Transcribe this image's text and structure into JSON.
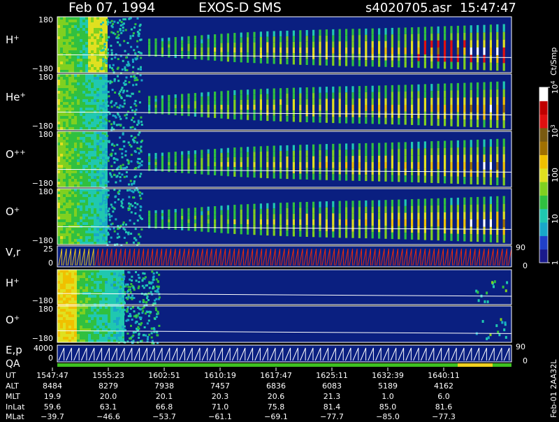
{
  "header": {
    "date": "Feb 07, 1994",
    "mission": "EXOS-D SMS",
    "file": "s4020705.asr",
    "time": "15:47:47"
  },
  "colors": {
    "background": "#000000",
    "spectrogram_floor": "#0a1f80",
    "vr_trace": "#e02a10",
    "qa_bar": "#3ec020",
    "qa_highlight": "#f0d020"
  },
  "chart_data": {
    "type": "heatmap",
    "panels": [
      {
        "key": "hp1",
        "label": "H",
        "sup": "+",
        "ymax": "180",
        "ymin": "−180"
      },
      {
        "key": "hep",
        "label": "He",
        "sup": "+",
        "ymax": "180",
        "ymin": "−180"
      },
      {
        "key": "opp",
        "label": "O",
        "sup": "++",
        "ymax": "180",
        "ymin": "−180"
      },
      {
        "key": "op1",
        "label": "O",
        "sup": "+",
        "ymax": "180",
        "ymin": "−180"
      },
      {
        "key": "vr",
        "label": "V,r",
        "sup": "",
        "ymax": "25",
        "ymin": "0",
        "right_top": "90",
        "right_bottom": "0"
      },
      {
        "key": "hp2",
        "label": "H",
        "sup": "+",
        "ymax": "",
        "ymin": "−180"
      },
      {
        "key": "op2",
        "label": "O",
        "sup": "+",
        "ymax": "180",
        "ymin": "−180"
      },
      {
        "key": "ep",
        "label": "E,p",
        "sup": "",
        "ymax": "4000",
        "ymin": "0",
        "right_top": "90",
        "right_bottom": "0"
      }
    ],
    "qa_label": "QA",
    "colorbar": {
      "unit": "Ct/Smp",
      "scale": "log",
      "range": [
        1,
        10000
      ],
      "ticks": [
        {
          "label": "1"
        },
        {
          "label": "10"
        },
        {
          "label": "100"
        },
        {
          "label": "10",
          "sup": "3"
        },
        {
          "label": "10",
          "sup": "4"
        }
      ],
      "colors": [
        "#1a1a8c",
        "#2040c8",
        "#18a8c8",
        "#20c8b0",
        "#30c040",
        "#80d020",
        "#e0e020",
        "#f0c000",
        "#a07000",
        "#7a5a10",
        "#e01010",
        "#c00000",
        "#ffffff"
      ]
    },
    "activity_profile": [
      0.0,
      0.0,
      0.05,
      0.15,
      0.3,
      0.45,
      0.55,
      0.62,
      0.68,
      0.72,
      0.78,
      0.85,
      0.92,
      1.0
    ],
    "side_label": "Feb-01 2AA32L",
    "footer": {
      "row_labels": [
        "UT",
        "ALT",
        "MLT",
        "InLat",
        "MLat"
      ],
      "columns": [
        [
          "1547:47",
          "8484",
          "19.9",
          "59.6",
          "−39.7"
        ],
        [
          "1555:23",
          "8279",
          "20.0",
          "63.1",
          "−46.6"
        ],
        [
          "1602:51",
          "7938",
          "20.1",
          "66.8",
          "−53.7"
        ],
        [
          "1610:19",
          "7457",
          "20.3",
          "71.0",
          "−61.1"
        ],
        [
          "1617:47",
          "6836",
          "20.6",
          "75.8",
          "−69.1"
        ],
        [
          "1625:11",
          "6083",
          "21.3",
          "81.4",
          "−77.7"
        ],
        [
          "1632:39",
          "5189",
          "1.0",
          "85.0",
          "−85.0"
        ],
        [
          "1640:11",
          "4162",
          "6.0",
          "81.6",
          "−77.3"
        ]
      ]
    }
  }
}
